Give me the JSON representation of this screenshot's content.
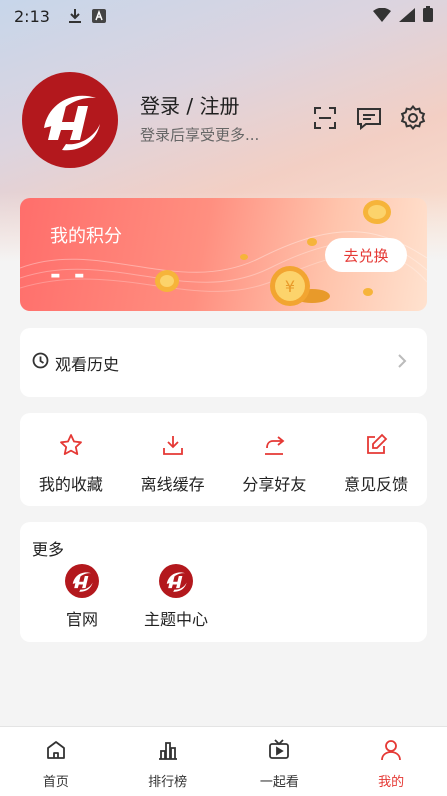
{
  "status_bar": {
    "time": "2:13",
    "icons": [
      "download-icon",
      "font-icon",
      "wifi-icon",
      "signal-icon",
      "battery-icon"
    ]
  },
  "header": {
    "avatar_icon": "brand-logo-icon",
    "title": "登录 / 注册",
    "subtitle": "登录后享受更多...",
    "icons": [
      "scan-icon",
      "message-icon",
      "settings-icon"
    ]
  },
  "points": {
    "title": "我的积分",
    "value": "- -",
    "redeem_label": "去兑换"
  },
  "history": {
    "icon": "clock-icon",
    "label": "观看历史"
  },
  "actions": [
    {
      "icon": "star-icon",
      "label": "我的收藏"
    },
    {
      "icon": "download-icon",
      "label": "离线缓存"
    },
    {
      "icon": "share-icon",
      "label": "分享好友"
    },
    {
      "icon": "edit-icon",
      "label": "意见反馈"
    }
  ],
  "more": {
    "title": "更多",
    "items": [
      {
        "icon": "brand-logo-icon",
        "label": "官网"
      },
      {
        "icon": "brand-logo-icon",
        "label": "主题中心"
      }
    ]
  },
  "bottom_nav": [
    {
      "icon": "home-icon",
      "label": "首页",
      "active": false
    },
    {
      "icon": "ranking-icon",
      "label": "排行榜",
      "active": false
    },
    {
      "icon": "tv-icon",
      "label": "一起看",
      "active": false
    },
    {
      "icon": "profile-icon",
      "label": "我的",
      "active": true
    }
  ],
  "colors": {
    "accent": "#e53935",
    "brand": "#b3181d",
    "background": "#f4f4f4"
  }
}
